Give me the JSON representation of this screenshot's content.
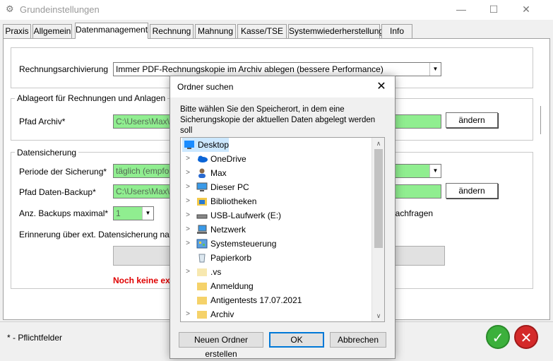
{
  "window": {
    "title": "Grundeinstellungen",
    "minimize_glyph": "—",
    "maximize_glyph": "☐",
    "close_glyph": "✕"
  },
  "tabs": [
    {
      "label": "Praxis",
      "active": false
    },
    {
      "label": "Allgemein",
      "active": false
    },
    {
      "label": "Datenmanagement",
      "active": true
    },
    {
      "label": "Rechnung",
      "active": false
    },
    {
      "label": "Mahnung",
      "active": false
    },
    {
      "label": "Kasse/TSE",
      "active": false
    },
    {
      "label": "Systemwiederherstellung",
      "active": false
    },
    {
      "label": "Info",
      "active": false
    }
  ],
  "archiving": {
    "label": "Rechnungsarchivierung",
    "value": "Immer PDF-Rechnungskopie im Archiv ablegen (bessere Performance)"
  },
  "storage_group": {
    "title": "Ablageort für Rechnungen und Anlagen",
    "path_label": "Pfad Archiv*",
    "path_value": "C:\\Users\\Max\\D",
    "change_button": "ändern"
  },
  "backup_group": {
    "title": "Datensicherung",
    "period_label": "Periode der Sicherung*",
    "period_value": "täglich (empfohle",
    "path_label": "Pfad Daten-Backup*",
    "path_value": "C:\\Users\\Max\\D",
    "change_button": "ändern",
    "max_label": "Anz. Backups maximal*",
    "max_value": "1",
    "ask_text": "g nachfragen",
    "reminder_label": "Erinnerung über ext. Datensicherung nach*",
    "warning": "Noch keine ext"
  },
  "footer": {
    "required_note": "* - Pflichtfelder"
  },
  "colors": {
    "field_green": "#90ee90",
    "ok_green": "#3cb03c",
    "cancel_red": "#d42a2a",
    "selection": "#cce8ff",
    "default_button_border": "#0078d7"
  },
  "dialog": {
    "title": "Ordner suchen",
    "close_glyph": "✕",
    "instruction_line1": "Bitte wählen Sie den Speicherort, in dem eine",
    "instruction_line2": "Sicherungskopie der aktuellen Daten abgelegt werden soll",
    "tree": [
      {
        "label": "Desktop",
        "icon": "desktop-icon",
        "expandable": false,
        "selected": true,
        "indent": 0
      },
      {
        "label": "OneDrive",
        "icon": "cloud-icon",
        "expandable": true,
        "selected": false,
        "indent": 1
      },
      {
        "label": "Max",
        "icon": "user-icon",
        "expandable": true,
        "selected": false,
        "indent": 1
      },
      {
        "label": "Dieser PC",
        "icon": "computer-icon",
        "expandable": true,
        "selected": false,
        "indent": 1
      },
      {
        "label": "Bibliotheken",
        "icon": "library-icon",
        "expandable": true,
        "selected": false,
        "indent": 1
      },
      {
        "label": "USB-Laufwerk (E:)",
        "icon": "usb-drive-icon",
        "expandable": true,
        "selected": false,
        "indent": 1
      },
      {
        "label": "Netzwerk",
        "icon": "network-icon",
        "expandable": true,
        "selected": false,
        "indent": 1
      },
      {
        "label": "Systemsteuerung",
        "icon": "control-panel-icon",
        "expandable": true,
        "selected": false,
        "indent": 1
      },
      {
        "label": "Papierkorb",
        "icon": "recycle-bin-icon",
        "expandable": false,
        "selected": false,
        "indent": 1
      },
      {
        "label": ".vs",
        "icon": "folder-icon",
        "expandable": true,
        "selected": false,
        "indent": 1
      },
      {
        "label": "Anmeldung",
        "icon": "folder-icon",
        "expandable": false,
        "selected": false,
        "indent": 1
      },
      {
        "label": "Antigentests 17.07.2021",
        "icon": "folder-icon",
        "expandable": false,
        "selected": false,
        "indent": 1
      },
      {
        "label": "Archiv",
        "icon": "folder-icon",
        "expandable": true,
        "selected": false,
        "indent": 1
      }
    ],
    "new_folder_button": "Neuen Ordner erstellen",
    "ok_button": "OK",
    "cancel_button": "Abbrechen"
  }
}
